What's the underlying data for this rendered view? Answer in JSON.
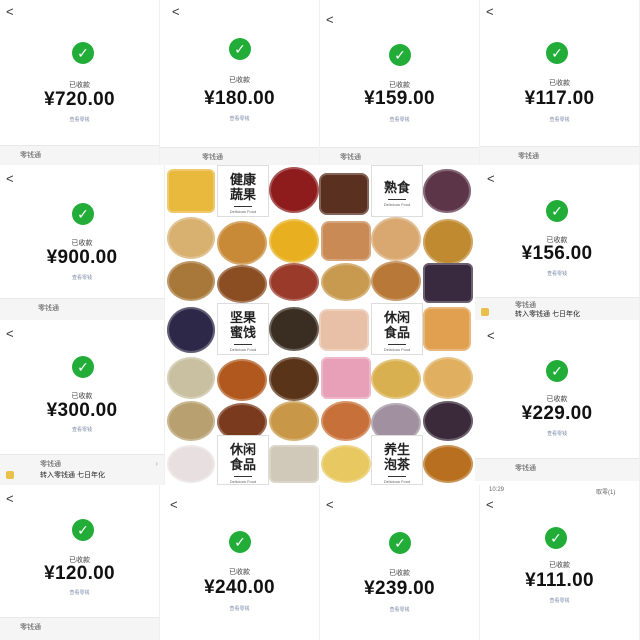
{
  "common": {
    "back_glyph": "<",
    "received_label": "已收款",
    "check_glyph": "✓"
  },
  "panels": [
    {
      "amount": "¥720.00",
      "sub": "查看零钱",
      "footer": "零钱通"
    },
    {
      "amount": "¥180.00",
      "sub": "查看零钱",
      "footer": "零钱通"
    },
    {
      "amount": "¥159.00",
      "sub": "查看零钱",
      "footer": "零钱通"
    },
    {
      "amount": "¥117.00",
      "sub": "查看零钱",
      "footer": "零钱通"
    },
    {
      "amount": "¥900.00",
      "sub": "查看零钱",
      "footer": "零钱通"
    },
    {
      "amount": "¥156.00",
      "sub": "查看零钱",
      "footer": "零钱通",
      "footer_line2": "转入零钱通 七日年化"
    },
    {
      "amount": "¥300.00",
      "sub": "查看零钱",
      "footer": "零钱通",
      "footer_line2": "转入零钱通 七日年化"
    },
    {
      "amount": "¥229.00",
      "sub": "查看零钱",
      "footer": "零钱通"
    },
    {
      "amount": "¥120.00",
      "sub": "查看零钱",
      "footer": "零钱通"
    },
    {
      "amount": "¥240.00",
      "sub": "查看零钱"
    },
    {
      "amount": "¥239.00",
      "sub": "查看零钱"
    },
    {
      "amount": "¥111.00",
      "sub": "查看零钱"
    }
  ],
  "collage": {
    "tiles": [
      {
        "line1": "健康",
        "line2": "蔬果",
        "en": "Delicious Food"
      },
      {
        "line1": "熟食",
        "line2": "",
        "en": "Delicious Food"
      },
      {
        "line1": "坚果",
        "line2": "蜜饯",
        "en": "Delicious Food"
      },
      {
        "line1": "休闲",
        "line2": "食品",
        "en": "Delicious Food"
      },
      {
        "line1": "休闲",
        "line2": "食品",
        "en": "Delicious Food"
      },
      {
        "line1": "养生",
        "line2": "泡茶",
        "en": "Delicious Food"
      }
    ],
    "time_text": "10:29",
    "strip_right": "取零(1)"
  },
  "colors": {
    "check_green": "#22ac38",
    "link_blue": "#7a8aa6"
  }
}
